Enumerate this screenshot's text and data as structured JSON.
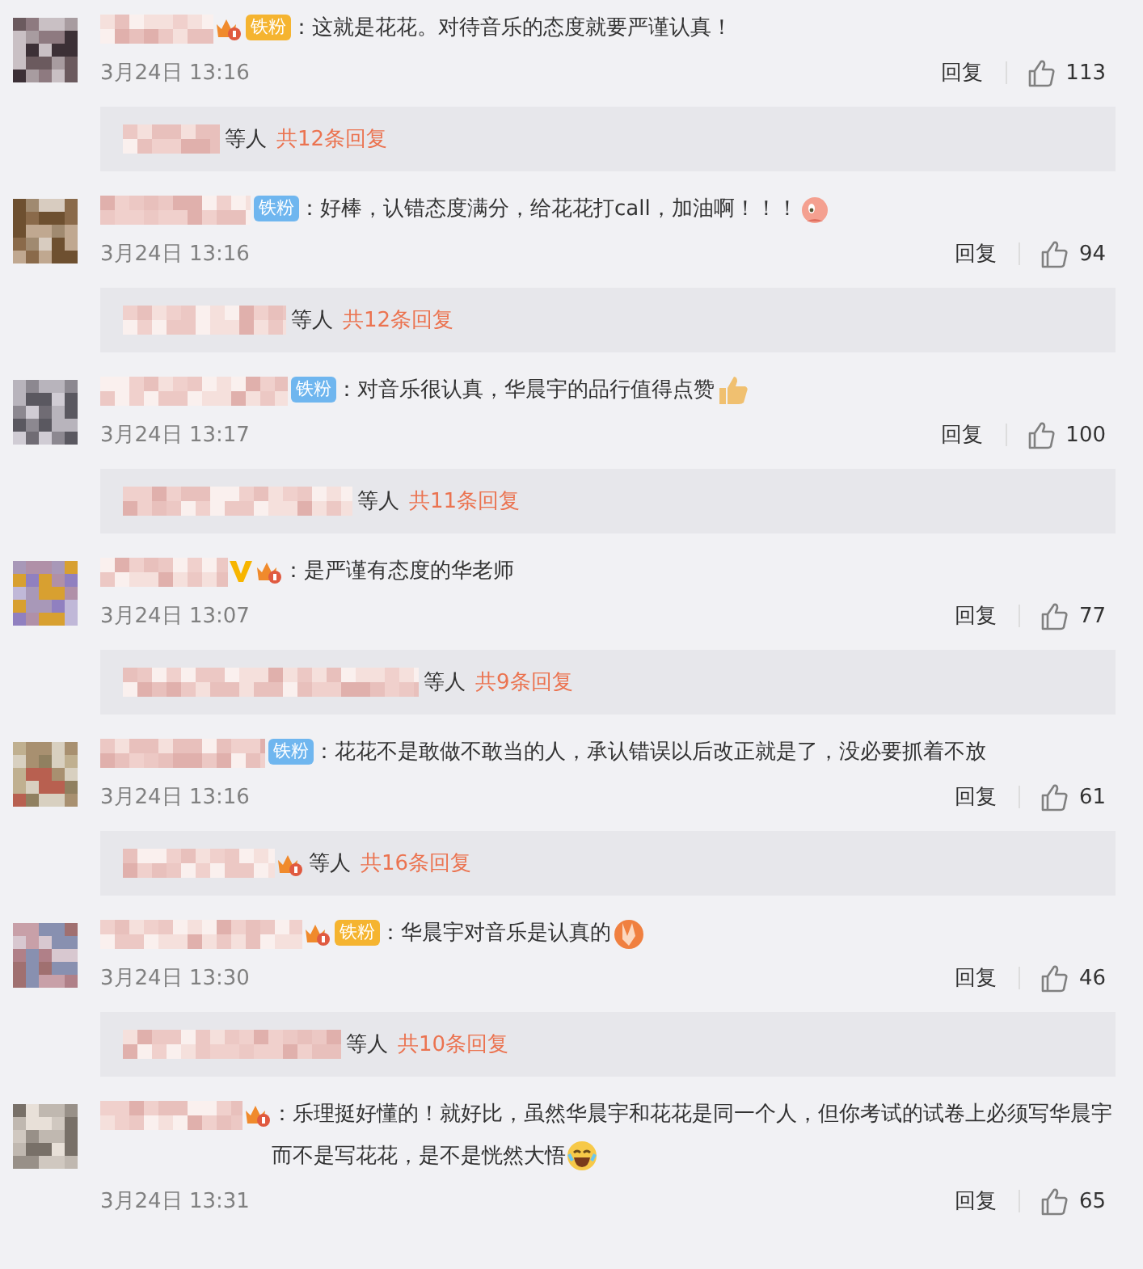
{
  "comments": [
    {
      "badges": [
        {
          "kind": "crown"
        },
        {
          "kind": "fan-gold",
          "label": "铁粉"
        }
      ],
      "text": "：这就是花花。对待音乐的态度就要严谨认真！",
      "time": "3月24日 13:16",
      "reply_label": "回复",
      "likes": "113",
      "replies": {
        "suffix": "等人",
        "count": "共12条回复"
      }
    },
    {
      "badges": [
        {
          "kind": "fan-blue",
          "label": "铁粉"
        }
      ],
      "text": "：好棒，认错态度满分，给花花打call，加油啊！！！",
      "emoji": {
        "kind": "creature"
      },
      "time": "3月24日 13:16",
      "reply_label": "回复",
      "likes": "94",
      "replies": {
        "suffix": "等人",
        "count": "共12条回复"
      }
    },
    {
      "badges": [
        {
          "kind": "fan-blue",
          "label": "铁粉"
        }
      ],
      "text": "：对音乐很认真，华晨宇的品行值得点赞",
      "emoji": {
        "kind": "thumbs-up"
      },
      "time": "3月24日 13:17",
      "reply_label": "回复",
      "likes": "100",
      "replies": {
        "suffix": "等人",
        "count": "共11条回复"
      }
    },
    {
      "badges": [
        {
          "kind": "verified"
        },
        {
          "kind": "crown"
        }
      ],
      "text": "：是严谨有态度的华老师",
      "time": "3月24日 13:07",
      "reply_label": "回复",
      "likes": "77",
      "replies": {
        "suffix": "等人",
        "count": "共9条回复"
      }
    },
    {
      "badges": [
        {
          "kind": "fan-blue",
          "label": "铁粉"
        }
      ],
      "text": "：花花不是敢做不敢当的人，承认错误以后改正就是了，没必要抓着不放",
      "time": "3月24日 13:16",
      "reply_label": "回复",
      "likes": "61",
      "replies": {
        "badges": [
          {
            "kind": "crown"
          }
        ],
        "suffix": "等人",
        "count": "共16条回复"
      }
    },
    {
      "badges": [
        {
          "kind": "crown"
        },
        {
          "kind": "fan-gold",
          "label": "铁粉"
        }
      ],
      "text": "：华晨宇对音乐是认真的",
      "emoji": {
        "kind": "hands"
      },
      "time": "3月24日 13:30",
      "reply_label": "回复",
      "likes": "46",
      "replies": {
        "suffix": "等人",
        "count": "共10条回复"
      }
    },
    {
      "badges": [
        {
          "kind": "crown"
        }
      ],
      "text": "：乐理挺好懂的！就好比，虽然华晨宇和花花是同一个人，但你考试的试卷上必须写华晨宇而不是写花花，是不是恍然大悟",
      "emoji": {
        "kind": "laugh"
      },
      "time": "3月24日 13:31",
      "reply_label": "回复",
      "likes": "65"
    }
  ]
}
